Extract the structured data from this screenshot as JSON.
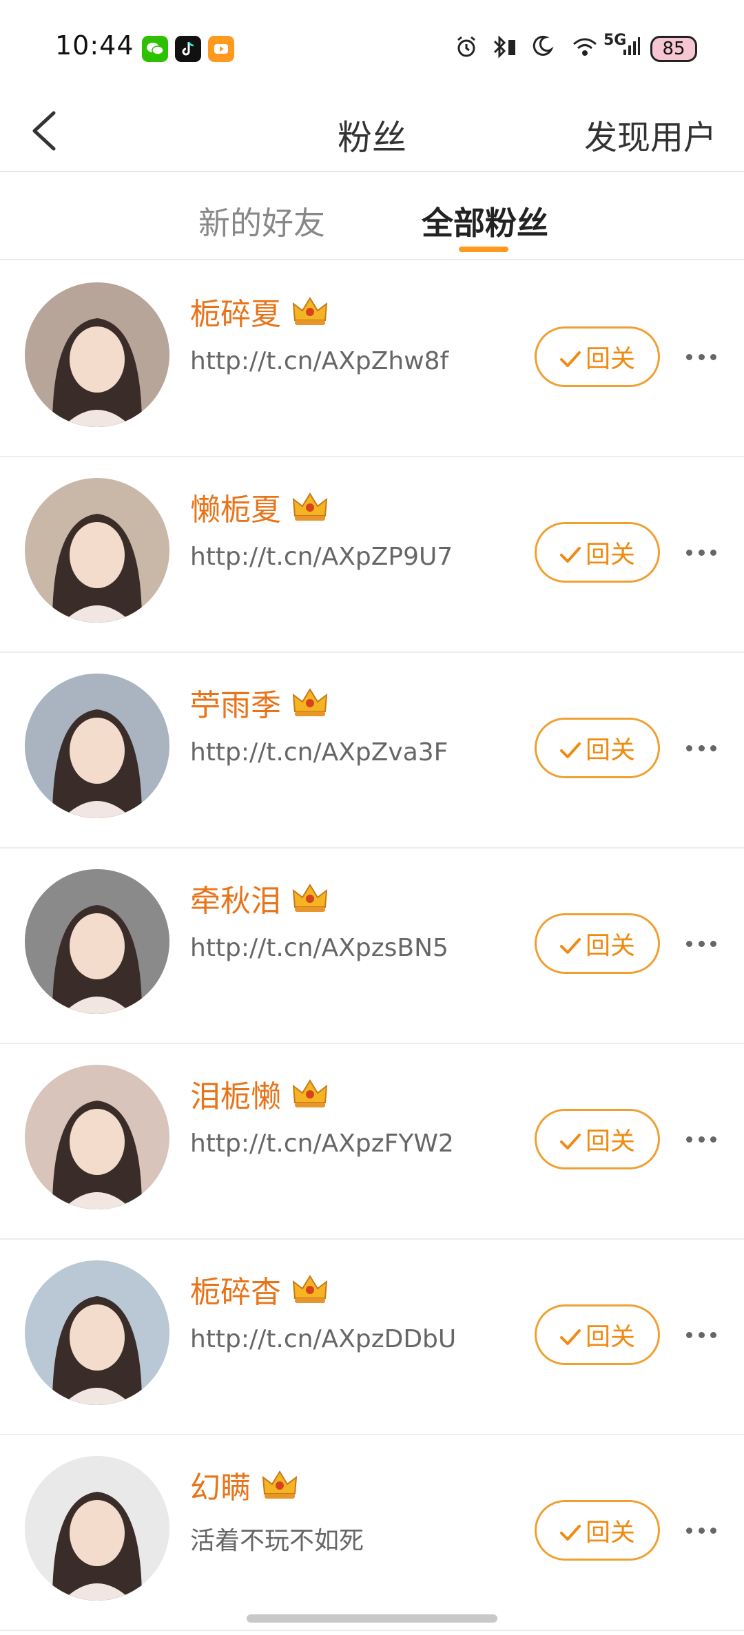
{
  "status_bar": {
    "time": "10:44",
    "battery": "85",
    "network": "5G",
    "apps": [
      "wechat-icon",
      "tiktok-icon",
      "video-app-icon"
    ]
  },
  "header": {
    "title": "粉丝",
    "right_action": "发现用户"
  },
  "tabs": [
    {
      "label": "新的好友",
      "active": false
    },
    {
      "label": "全部粉丝",
      "active": true
    }
  ],
  "colors": {
    "accent": "#ff9a1f",
    "name_color": "#e8741a",
    "follow_border": "#f0a030"
  },
  "followers": [
    {
      "name": "栀碎夏",
      "desc": "http://t.cn/AXpZhw8f",
      "button": "回关",
      "avatar_tone": "#b7a59a"
    },
    {
      "name": "懒栀夏",
      "desc": "http://t.cn/AXpZP9U7",
      "button": "回关",
      "avatar_tone": "#c9b8a8"
    },
    {
      "name": "苧雨季",
      "desc": "http://t.cn/AXpZva3F",
      "button": "回关",
      "avatar_tone": "#a9b4c0"
    },
    {
      "name": "牵秋泪",
      "desc": "http://t.cn/AXpzsBN5",
      "button": "回关",
      "avatar_tone": "#8a8a8a"
    },
    {
      "name": "泪栀懒",
      "desc": "http://t.cn/AXpzFYW2",
      "button": "回关",
      "avatar_tone": "#d9c4bb"
    },
    {
      "name": "栀碎杳",
      "desc": "http://t.cn/AXpzDDbU",
      "button": "回关",
      "avatar_tone": "#b9c8d4"
    },
    {
      "name": "幻瞒",
      "desc": "活着不玩不如死",
      "button": "回关",
      "avatar_tone": "#e9e9e9"
    }
  ]
}
